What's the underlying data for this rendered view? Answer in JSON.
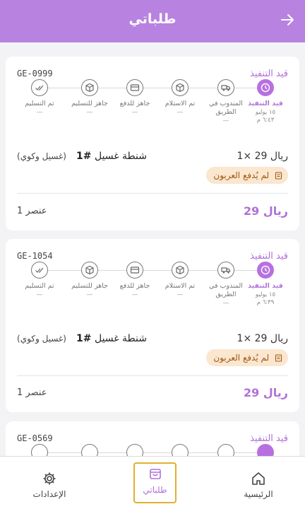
{
  "header": {
    "title": "طلباتي",
    "back_icon": "arrow-right-icon"
  },
  "steps": [
    {
      "label": "قيد التنفيذ",
      "icon": "clock-icon"
    },
    {
      "label": "المندوب في الطريق",
      "icon": "truck-icon"
    },
    {
      "label": "تم الاستلام",
      "icon": "box-icon"
    },
    {
      "label": "جاهز للدفع",
      "icon": "card-icon"
    },
    {
      "label": "جاهز للتسليم",
      "icon": "box-icon"
    },
    {
      "label": "تم التسليم",
      "icon": "check-double-icon"
    }
  ],
  "orders": [
    {
      "status": "قيد التنفيذ",
      "code": "GE-0999",
      "active_date": "١٥ يوليو",
      "active_time": "٦:٤٣ م",
      "dash": "—",
      "item_qty": "1× 29 ريال",
      "item_name": "شنطة غسيل ",
      "item_num": "#1",
      "item_option": "(غسيل وكوي)",
      "payment_badge": "لم يُدفع العربون",
      "total": "29 ريال",
      "count": "1 عنصر"
    },
    {
      "status": "قيد التنفيذ",
      "code": "GE-1054",
      "active_date": "١٥ يوليو",
      "active_time": "٦:٣٩ م",
      "dash": "—",
      "item_qty": "1× 29 ريال",
      "item_name": "شنطة غسيل ",
      "item_num": "#1",
      "item_option": "(غسيل وكوي)",
      "payment_badge": "لم يُدفع العربون",
      "total": "29 ريال",
      "count": "1 عنصر"
    },
    {
      "status": "قيد التنفيذ",
      "code": "GE-0569"
    }
  ],
  "tabbar": {
    "home": "الرئيسية",
    "orders": "طلباتي",
    "settings": "الإعدادات"
  },
  "colors": {
    "accent": "#b882e0",
    "badge_bg": "#fbe6cf",
    "badge_text": "#9a5a12"
  }
}
